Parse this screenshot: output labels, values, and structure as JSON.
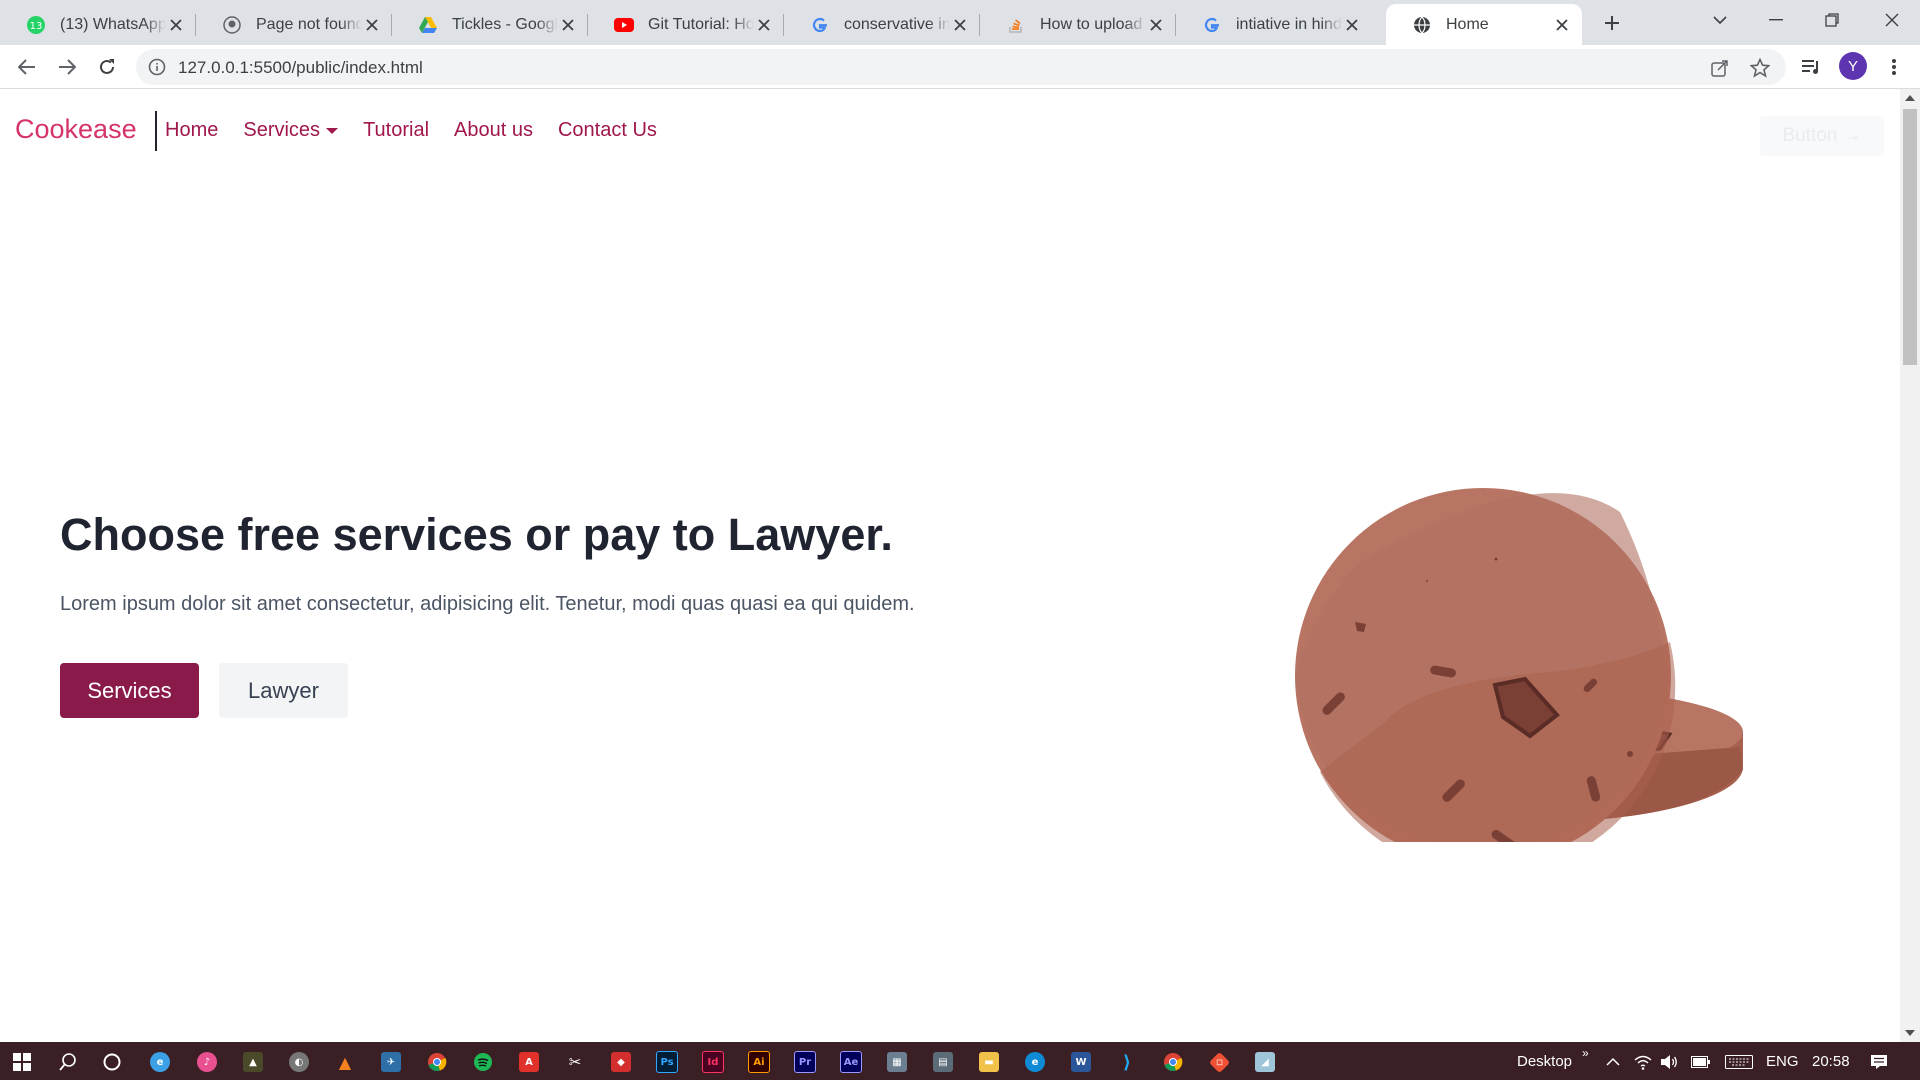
{
  "browser": {
    "tabs": [
      {
        "title": "(13) WhatsApp",
        "favicon": "whatsapp-icon",
        "badge": "13"
      },
      {
        "title": "Page not found · GitHub",
        "favicon": "github-icon"
      },
      {
        "title": "Tickles - Google Drive",
        "favicon": "google-drive-icon"
      },
      {
        "title": "Git Tutorial: How to",
        "favicon": "youtube-icon"
      },
      {
        "title": "conservative in hindi",
        "favicon": "google-icon"
      },
      {
        "title": "How to upload folder",
        "favicon": "stackoverflow-icon"
      },
      {
        "title": "intiative in hindi - Google",
        "favicon": "google-icon"
      },
      {
        "title": "Home",
        "favicon": "globe-icon",
        "active": true
      }
    ],
    "url": "127.0.0.1:5500/public/index.html",
    "profile_initial": "Y",
    "profile_color": "#5e35b1"
  },
  "page": {
    "brand": "Cookease",
    "nav": {
      "home": "Home",
      "services": "Services",
      "tutorial": "Tutorial",
      "about": "About us",
      "contact": "Contact Us"
    },
    "header_button": "Button →",
    "hero": {
      "title": "Choose free services or pay to Lawyer.",
      "subtitle": "Lorem ipsum dolor sit amet consectetur, adipisicing elit. Tenetur, modi quas quasi ea qui quidem.",
      "primary_button": "Services",
      "secondary_button": "Lawyer"
    },
    "colors": {
      "brand": "#d6336c",
      "nav_link": "#a0174e",
      "primary_button": "#8a1a4a",
      "cookie": "#b87563"
    }
  },
  "taskbar": {
    "desktop_label": "Desktop",
    "language": "ENG",
    "time": "20:58"
  }
}
